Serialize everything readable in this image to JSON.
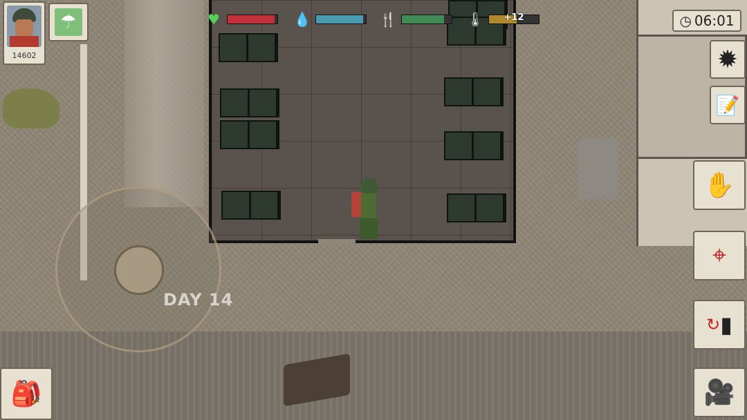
{
  "player": {
    "score": "14602"
  },
  "stats": {
    "health": {
      "icon": "heart-plus-icon",
      "level": 0.95,
      "color": "#c2313a"
    },
    "thirst": {
      "icon": "water-drop-icon",
      "level": 0.95,
      "color": "#4a9ab0"
    },
    "hunger": {
      "icon": "fork-knife-icon",
      "level": 0.85,
      "color": "#3f8a55"
    },
    "temperature": {
      "icon": "thermometer-icon",
      "label": "+12",
      "level": 0.55,
      "color": "#b08a2a"
    }
  },
  "clock": {
    "time": "06:01"
  },
  "world": {
    "day_label": "DAY 14"
  },
  "buttons": {
    "settings": "settings-gear-icon",
    "notes": "notepad-icon",
    "interact": "hand-icon",
    "aim": "crosshair-icon",
    "swap_weapon": "swap-weapon-icon",
    "camera": "camera-icon",
    "inventory": "backpack-icon",
    "airdrop": "parachute-icon"
  }
}
